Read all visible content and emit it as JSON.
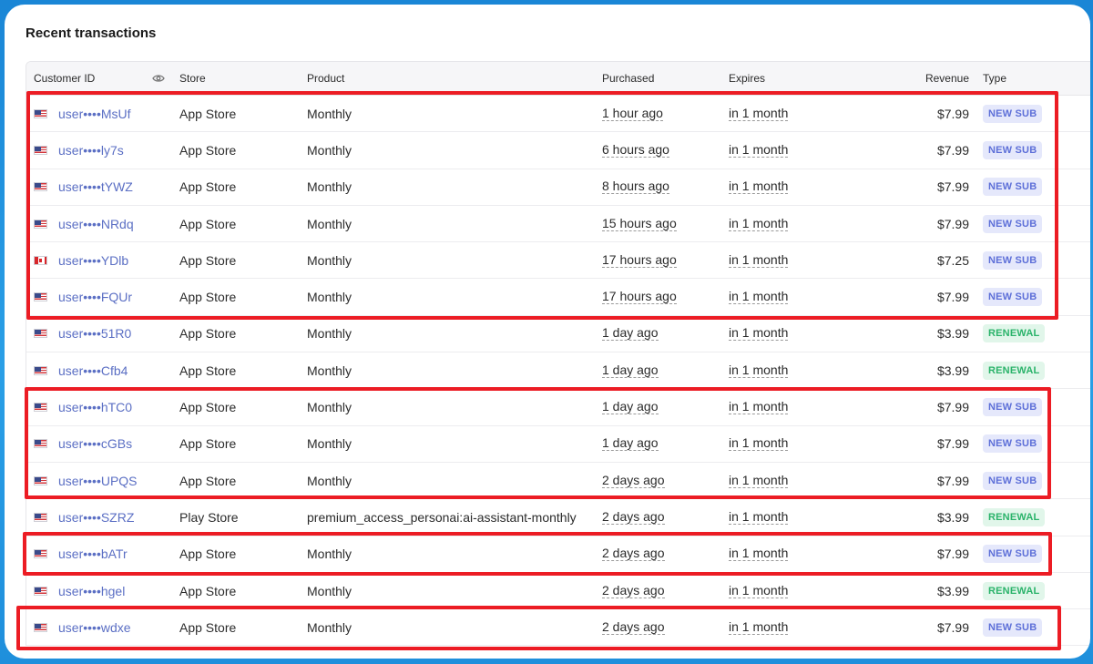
{
  "title": "Recent transactions",
  "columns": {
    "customer_id": "Customer ID",
    "store": "Store",
    "product": "Product",
    "purchased": "Purchased",
    "expires": "Expires",
    "revenue": "Revenue",
    "type": "Type"
  },
  "rows": [
    {
      "flag": "us",
      "customer": "user••••MsUf",
      "store": "App Store",
      "product": "Monthly",
      "purchased": "1 hour ago",
      "expires": "in 1 month",
      "revenue": "$7.99",
      "type": "NEW SUB"
    },
    {
      "flag": "us",
      "customer": "user••••ly7s",
      "store": "App Store",
      "product": "Monthly",
      "purchased": "6 hours ago",
      "expires": "in 1 month",
      "revenue": "$7.99",
      "type": "NEW SUB"
    },
    {
      "flag": "us",
      "customer": "user••••tYWZ",
      "store": "App Store",
      "product": "Monthly",
      "purchased": "8 hours ago",
      "expires": "in 1 month",
      "revenue": "$7.99",
      "type": "NEW SUB"
    },
    {
      "flag": "us",
      "customer": "user••••NRdq",
      "store": "App Store",
      "product": "Monthly",
      "purchased": "15 hours ago",
      "expires": "in 1 month",
      "revenue": "$7.99",
      "type": "NEW SUB"
    },
    {
      "flag": "ca",
      "customer": "user••••YDlb",
      "store": "App Store",
      "product": "Monthly",
      "purchased": "17 hours ago",
      "expires": "in 1 month",
      "revenue": "$7.25",
      "type": "NEW SUB"
    },
    {
      "flag": "us",
      "customer": "user••••FQUr",
      "store": "App Store",
      "product": "Monthly",
      "purchased": "17 hours ago",
      "expires": "in 1 month",
      "revenue": "$7.99",
      "type": "NEW SUB"
    },
    {
      "flag": "us",
      "customer": "user••••51R0",
      "store": "App Store",
      "product": "Monthly",
      "purchased": "1 day ago",
      "expires": "in 1 month",
      "revenue": "$3.99",
      "type": "RENEWAL"
    },
    {
      "flag": "us",
      "customer": "user••••Cfb4",
      "store": "App Store",
      "product": "Monthly",
      "purchased": "1 day ago",
      "expires": "in 1 month",
      "revenue": "$3.99",
      "type": "RENEWAL"
    },
    {
      "flag": "us",
      "customer": "user••••hTC0",
      "store": "App Store",
      "product": "Monthly",
      "purchased": "1 day ago",
      "expires": "in 1 month",
      "revenue": "$7.99",
      "type": "NEW SUB"
    },
    {
      "flag": "us",
      "customer": "user••••cGBs",
      "store": "App Store",
      "product": "Monthly",
      "purchased": "1 day ago",
      "expires": "in 1 month",
      "revenue": "$7.99",
      "type": "NEW SUB"
    },
    {
      "flag": "us",
      "customer": "user••••UPQS",
      "store": "App Store",
      "product": "Monthly",
      "purchased": "2 days ago",
      "expires": "in 1 month",
      "revenue": "$7.99",
      "type": "NEW SUB"
    },
    {
      "flag": "us",
      "customer": "user••••SZRZ",
      "store": "Play Store",
      "product": "premium_access_personai:ai-assistant-monthly",
      "purchased": "2 days ago",
      "expires": "in 1 month",
      "revenue": "$3.99",
      "type": "RENEWAL"
    },
    {
      "flag": "us",
      "customer": "user••••bATr",
      "store": "App Store",
      "product": "Monthly",
      "purchased": "2 days ago",
      "expires": "in 1 month",
      "revenue": "$7.99",
      "type": "NEW SUB"
    },
    {
      "flag": "us",
      "customer": "user••••hgel",
      "store": "App Store",
      "product": "Monthly",
      "purchased": "2 days ago",
      "expires": "in 1 month",
      "revenue": "$3.99",
      "type": "RENEWAL"
    },
    {
      "flag": "us",
      "customer": "user••••wdxe",
      "store": "App Store",
      "product": "Monthly",
      "purchased": "2 days ago",
      "expires": "in 1 month",
      "revenue": "$7.99",
      "type": "NEW SUB"
    }
  ],
  "highlight_color": "#ec1c24",
  "icons": {
    "column_visibility": "eye-icon"
  }
}
